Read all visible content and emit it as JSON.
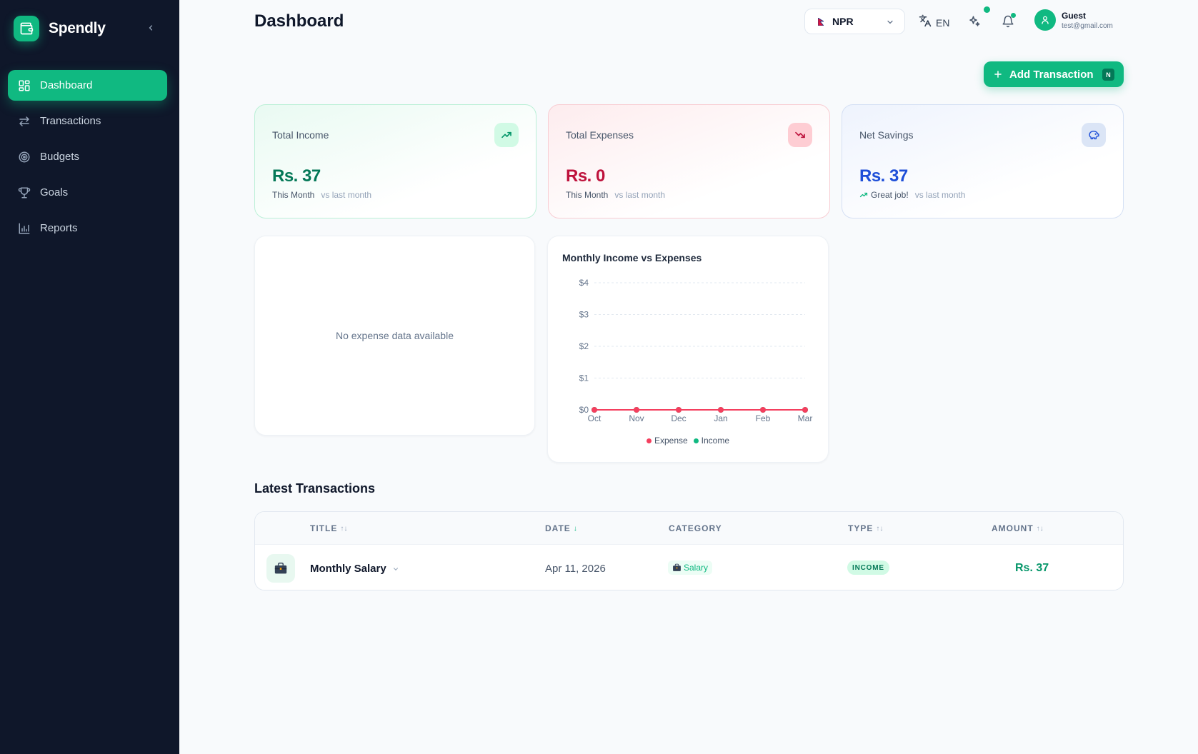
{
  "app": {
    "name": "Spendly"
  },
  "sidebar": {
    "items": [
      {
        "label": "Dashboard",
        "icon": "dashboard-grid-icon",
        "active": true
      },
      {
        "label": "Transactions",
        "icon": "arrows-swap-icon"
      },
      {
        "label": "Budgets",
        "icon": "target-icon"
      },
      {
        "label": "Goals",
        "icon": "trophy-icon"
      },
      {
        "label": "Reports",
        "icon": "bar-chart-icon"
      }
    ]
  },
  "header": {
    "title": "Dashboard",
    "currency": "NPR",
    "language": "EN",
    "user": {
      "name": "Guest",
      "email": "test@gmail.com"
    }
  },
  "actions": {
    "add_transaction": "Add Transaction",
    "shortcut_key": "N"
  },
  "stats": {
    "income": {
      "label": "Total Income",
      "value": "Rs. 37",
      "period": "This Month",
      "compare": "vs last month",
      "color": "#047857"
    },
    "expenses": {
      "label": "Total Expenses",
      "value": "Rs. 0",
      "period": "This Month",
      "compare": "vs last month",
      "color": "#be123c"
    },
    "savings": {
      "label": "Net Savings",
      "value": "Rs. 37",
      "period": "Great job!",
      "compare": "vs last month",
      "color": "#1d4ed8"
    }
  },
  "expense_panel": {
    "empty_text": "No expense data available"
  },
  "chart_data": {
    "type": "line",
    "title": "Monthly Income vs Expenses",
    "x": [
      "Oct",
      "Nov",
      "Dec",
      "Jan",
      "Feb",
      "Mar"
    ],
    "y_ticks": [
      "$0",
      "$1",
      "$2",
      "$3",
      "$4"
    ],
    "ylim": [
      0,
      4
    ],
    "grid": true,
    "legend": "bottom",
    "series": [
      {
        "name": "Expense",
        "values": [
          0,
          0,
          0,
          0,
          0,
          0
        ],
        "color": "#f43f5e"
      },
      {
        "name": "Income",
        "values": [
          0,
          0,
          0,
          0,
          0,
          0
        ],
        "color": "#10b981"
      }
    ]
  },
  "transactions": {
    "title": "Latest Transactions",
    "columns": {
      "title": "TITLE",
      "date": "DATE",
      "category": "CATEGORY",
      "type": "TYPE",
      "amount": "AMOUNT"
    },
    "rows": [
      {
        "title": "Monthly Salary",
        "date": "Apr 11, 2026",
        "category": "Salary",
        "type": "INCOME",
        "amount": "Rs. 37",
        "icon": "briefcase-icon"
      }
    ]
  },
  "colors": {
    "accent": "#10b981",
    "sidebar_bg": "#0f172a",
    "expense": "#f43f5e"
  }
}
